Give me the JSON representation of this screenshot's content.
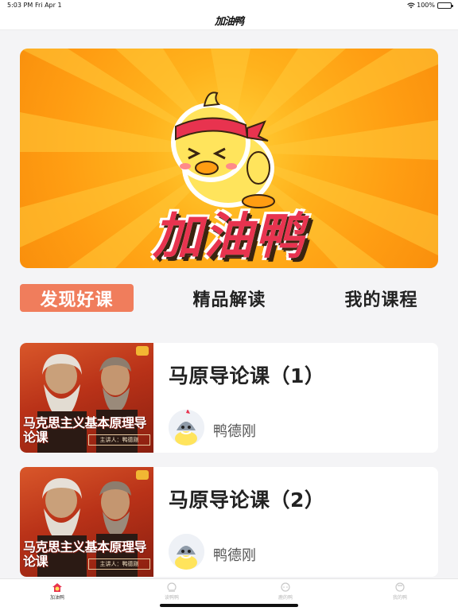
{
  "status_bar": {
    "time": "5:03 PM",
    "date": "Fri Apr 1",
    "battery": "100%"
  },
  "nav": {
    "title": "加油鸭"
  },
  "banner": {
    "title": "加油鸭"
  },
  "tabs": [
    {
      "label": "发现好课",
      "active": true
    },
    {
      "label": "精品解读",
      "active": false
    },
    {
      "label": "我的课程",
      "active": false
    }
  ],
  "courses": [
    {
      "title": "马原导论课（1）",
      "thumb_title": "马克思主义基本原理导论课",
      "thumb_instructor": "主讲人：鸭德刚",
      "teacher": "鸭德刚"
    },
    {
      "title": "马原导论课（2）",
      "thumb_title": "马克思主义基本原理导论课",
      "thumb_instructor": "主讲人：鸭德刚",
      "teacher": "鸭德刚"
    }
  ],
  "tab_bar": [
    {
      "label": "加油鸭",
      "icon": "duck-home-icon",
      "active": true
    },
    {
      "label": "读鸭鸭",
      "icon": "duck-read-icon",
      "active": false
    },
    {
      "label": "鹿的鸭",
      "icon": "duck-discover-icon",
      "active": false
    },
    {
      "label": "我的鸭",
      "icon": "duck-profile-icon",
      "active": false
    }
  ],
  "colors": {
    "accent": "#f07d5c",
    "banner_orange": "#ffa91a",
    "banner_red": "#e8334f",
    "thumb_red": "#b93218"
  }
}
